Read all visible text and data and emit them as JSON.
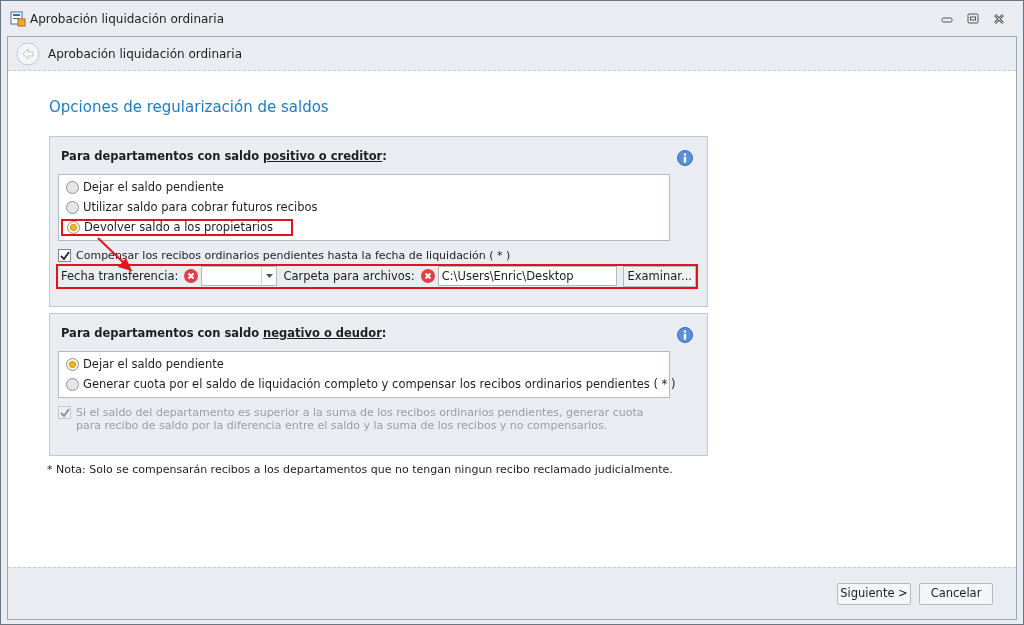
{
  "window": {
    "title": "Aprobación liquidación ordinaria"
  },
  "header": {
    "title": "Aprobación liquidación ordinaria"
  },
  "heading": "Opciones de regularización de saldos",
  "sections": [
    {
      "title_before": "Para departamentos con saldo ",
      "title_emphasis": "positivo o creditor",
      "title_after": ":",
      "options": [
        {
          "label": "Dejar el saldo pendiente",
          "selected": false,
          "highlighted": false
        },
        {
          "label": "Utilizar saldo para cobrar futuros recibos",
          "selected": false,
          "highlighted": false
        },
        {
          "label": "Devolver saldo a los propietarios",
          "selected": true,
          "highlighted": true
        }
      ],
      "checkbox": {
        "label": "Compensar los recibos ordinarios pendientes hasta la fecha de liquidación ( * )",
        "checked": true,
        "disabled": false
      },
      "fields": {
        "highlighted": true,
        "date_label": "Fecha transferencia:",
        "folder_label": "Carpeta para archivos:",
        "folder_value": "C:\\Users\\Enric\\Desktop",
        "browse_button": "Examinar..."
      }
    },
    {
      "title_before": "Para departamentos con saldo ",
      "title_emphasis": "negativo o deudor",
      "title_after": ":",
      "options": [
        {
          "label": "Dejar el saldo pendiente",
          "selected": true,
          "highlighted": false
        },
        {
          "label": "Generar cuota por el saldo de liquidación completo y compensar los recibos ordinarios pendientes ( * )",
          "selected": false,
          "highlighted": false
        }
      ],
      "checkbox": {
        "label": "Si el saldo del departamento es superior a la suma de los recibos ordinarios pendientes, generar cuota para recibo de saldo por la diferencia entre el saldo y la suma de los recibos y no compensarlos.",
        "checked": true,
        "disabled": true
      }
    }
  ],
  "note": "* Nota: Solo se compensarán recibos a los departamentos que no tengan ningun recibo reclamado judicialmente.",
  "buttons": [
    "Siguiente >",
    "Cancelar"
  ]
}
